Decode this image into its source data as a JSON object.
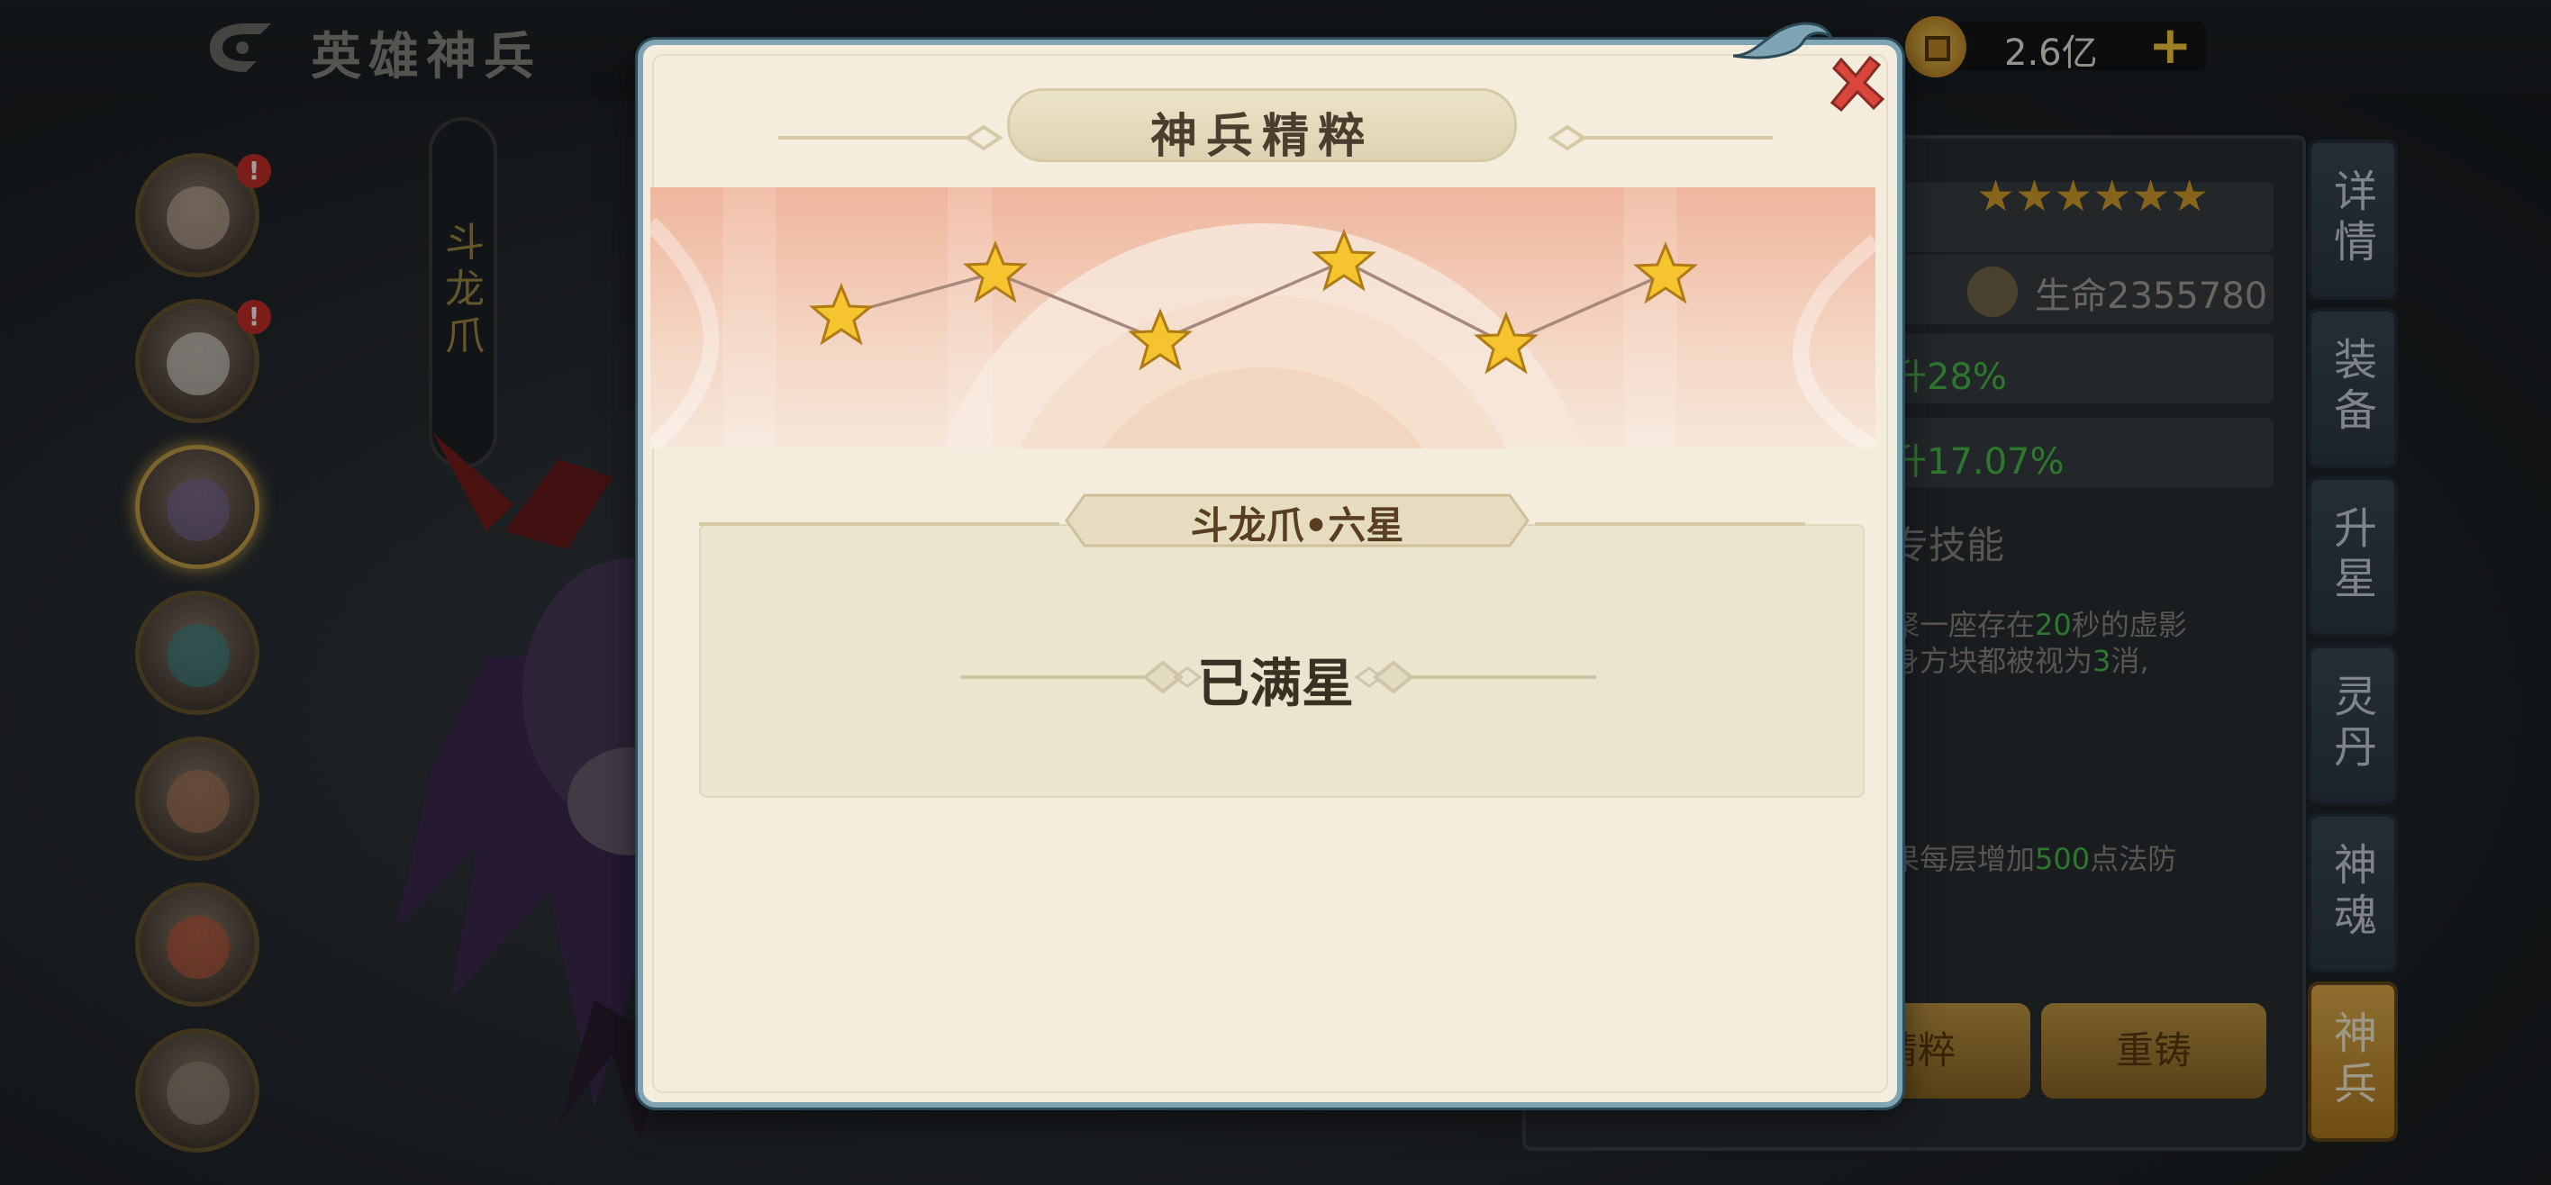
{
  "header": {
    "title": "英雄神兵",
    "currency_value": "2.6亿",
    "currency_plus": "+"
  },
  "hero_list": {
    "badge": "!"
  },
  "weapon_tab": {
    "label": "斗龙爪"
  },
  "right_panel": {
    "stars": "★★★★★★",
    "hp": "生命2355780",
    "stat1": "升28%",
    "stat2": "升17.07%",
    "skill_title": "专技能",
    "skill_line1_a": "聚一座存在",
    "skill_line1_num": "20",
    "skill_line1_b": "秒的虚影",
    "skill_line2_a": "身方块都被视为",
    "skill_line2_num": "3",
    "skill_line2_b": "消,",
    "skill_line3_a": "果每层增加",
    "skill_line3_num": "500",
    "skill_line3_b": "点法防",
    "button_essence": "精粹",
    "button_reforge": "重铸"
  },
  "side_tabs": [
    {
      "label": "详情",
      "active": false
    },
    {
      "label": "装备",
      "active": false
    },
    {
      "label": "升星",
      "active": false
    },
    {
      "label": "灵丹",
      "active": false
    },
    {
      "label": "神魂",
      "active": false
    },
    {
      "label": "神兵",
      "active": true
    }
  ],
  "modal": {
    "title": "神兵精粹",
    "stage_label": "斗龙爪•六星",
    "status": "已满星",
    "stars_filled": 6,
    "stars_total": 6,
    "colors": {
      "accent": "#7fa4b4",
      "star": "#f5c42e",
      "close": "#d8463c"
    }
  }
}
